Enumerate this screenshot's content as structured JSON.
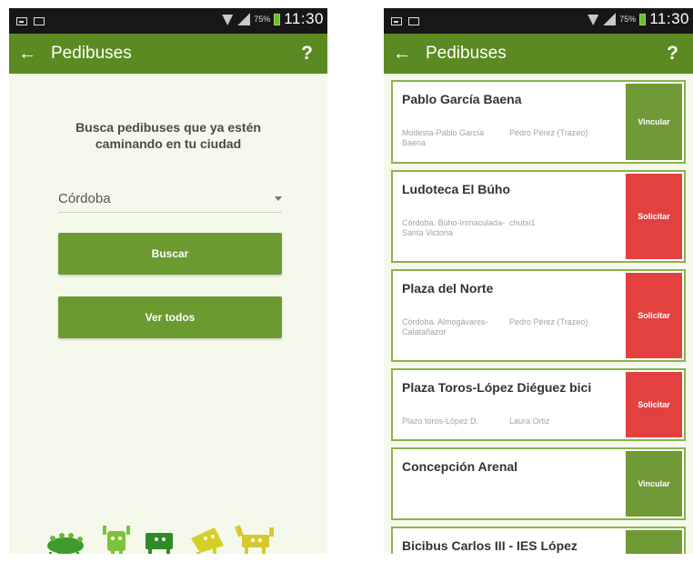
{
  "status_bar": {
    "time": "11:30",
    "battery_percent": "75%"
  },
  "left_screen": {
    "app_bar": {
      "title": "Pedibuses",
      "help": "?",
      "back": "←"
    },
    "intro_text": "Busca pedibuses que ya estén caminando en tu ciudad",
    "city_select": {
      "value": "Córdoba"
    },
    "buttons": {
      "search": "Buscar",
      "view_all": "Ver todos"
    }
  },
  "right_screen": {
    "app_bar": {
      "title": "Pedibuses",
      "help": "?",
      "back": "←"
    },
    "cards": [
      {
        "title": "Pablo García Baena",
        "route": "Modesta-Pablo García Baena",
        "owner": "Pedro Pérez (Trazeo)",
        "action": "Vincular",
        "action_type": "vincular"
      },
      {
        "title": "Ludoteca El Búho",
        "route": "Córdoba. Búho-Inmaculada-Santa Victoria",
        "owner": "chutsi1",
        "action": "Solicitar",
        "action_type": "solicitar"
      },
      {
        "title": "Plaza del Norte",
        "route": "Córdoba. Almogávares-Calatañazor",
        "owner": "Pedro Pérez (Trazeo)",
        "action": "Solicitar",
        "action_type": "solicitar"
      },
      {
        "title": "Plaza Toros-López Diéguez bici",
        "route": "Plazo toros-López D.",
        "owner": "Laura Ortiz",
        "action": "Solicitar",
        "action_type": "solicitar"
      },
      {
        "title": "Concepción Arenal",
        "route": "",
        "owner": "",
        "action": "Vincular",
        "action_type": "vincular"
      },
      {
        "title": "Bicibus Carlos III - IES López",
        "route": "",
        "owner": "",
        "action": "",
        "action_type": "vincular"
      }
    ]
  },
  "colors": {
    "primary": "#5c8a22",
    "button_green": "#6a9a30",
    "request_red": "#e34040",
    "background": "#f4f9ec"
  },
  "icons": [
    "picture-icon",
    "notification-icon",
    "wifi-icon",
    "signal-icon",
    "battery-icon",
    "back-arrow-icon",
    "help-icon",
    "dropdown-caret-icon"
  ]
}
